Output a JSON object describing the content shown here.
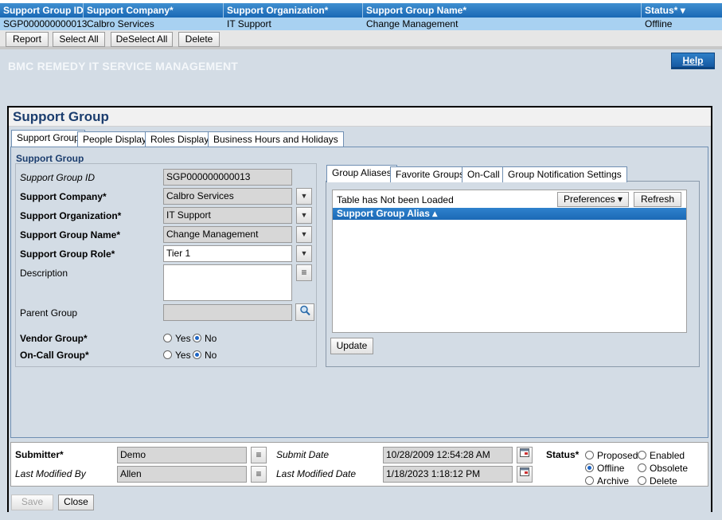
{
  "results_table": {
    "columns": [
      "Support Group ID",
      "Support Company*",
      "Support Organization*",
      "Support Group Name*",
      "Status*"
    ],
    "row": [
      "SGP000000000013",
      "Calbro Services",
      "IT Support",
      "Change Management",
      "Offline"
    ],
    "status_sort_icon": "▾"
  },
  "toolbar": {
    "report": "Report",
    "select_all": "Select All",
    "deselect_all": "DeSelect All",
    "delete": "Delete"
  },
  "header": {
    "brand": "BMC REMEDY IT SERVICE MANAGEMENT",
    "help": "Help"
  },
  "form": {
    "title": "Support Group",
    "tabs": [
      "Support Group",
      "People Display",
      "Roles Display",
      "Business Hours and Holidays"
    ],
    "section_label": "Support Group",
    "fields": {
      "id_label": "Support Group ID",
      "id_value": "SGP000000000013",
      "company_label": "Support Company*",
      "company_value": "Calbro Services",
      "org_label": "Support Organization*",
      "org_value": "IT Support",
      "name_label": "Support Group Name*",
      "name_value": "Change Management",
      "role_label": "Support Group Role*",
      "role_value": "Tier 1",
      "description_label": "Description",
      "parent_label": "Parent Group",
      "vendor_label": "Vendor Group*",
      "oncall_label": "On-Call Group*",
      "yes": "Yes",
      "no": "No"
    },
    "sub_tabs": [
      "Group Aliases",
      "Favorite Groups",
      "On-Call",
      "Group Notification Settings"
    ],
    "alias_table": {
      "status": "Table has Not been Loaded",
      "preferences": "Preferences",
      "refresh": "Refresh",
      "column": "Support Group Alias",
      "sort_icon": "▴"
    },
    "update_button": "Update"
  },
  "footer": {
    "submitter_label": "Submitter*",
    "submitter_value": "Demo",
    "last_modified_by_label": "Last Modified By",
    "last_modified_by_value": "Allen",
    "submit_date_label": "Submit Date",
    "submit_date_value": "10/28/2009 12:54:28 AM",
    "last_modified_date_label": "Last Modified Date",
    "last_modified_date_value": "1/18/2023 1:18:12 PM",
    "status_label": "Status*",
    "status_options": [
      "Proposed",
      "Enabled",
      "Offline",
      "Obsolete",
      "Archive",
      "Delete"
    ],
    "selected_status": "Offline"
  },
  "bottom": {
    "save": "Save",
    "close": "Close"
  },
  "colors": {
    "header_blue": "#1a68b5",
    "selected_row": "#a8d1f1",
    "panel_bg": "#d3dce5",
    "title_blue": "#1b3d6e"
  }
}
